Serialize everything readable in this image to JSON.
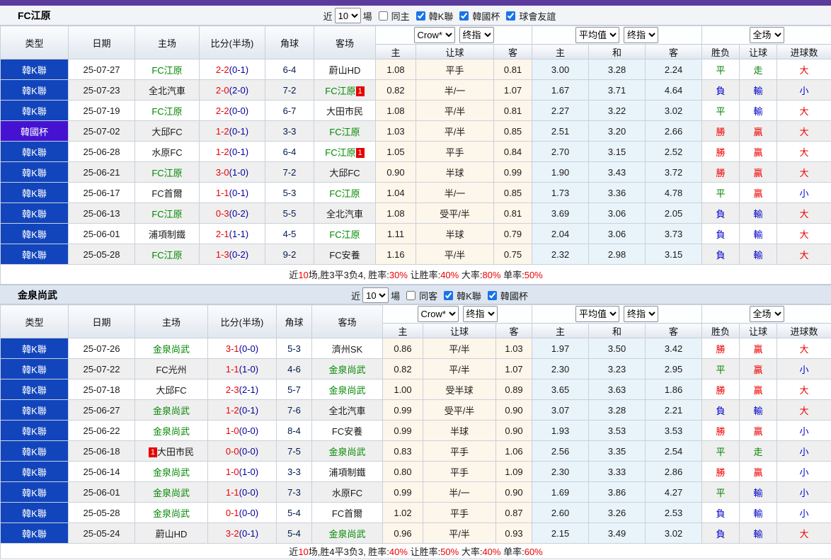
{
  "colors": {
    "accent_topbar": "#5b3c9c",
    "league_kleague": "#1245bc",
    "league_cup": "#4612d2",
    "team_focus_green": "#008800",
    "score_ft_red": "#ee0000",
    "score_ht_navy": "#0000a0",
    "checkbox_blue": "#1a73e8"
  },
  "res_colors": {
    "勝": "red",
    "贏": "red",
    "大": "red",
    "平": "green",
    "走": "green",
    "負": "blue",
    "輸": "blue",
    "小": "blue"
  },
  "columns": {
    "type": "类型",
    "date": "日期",
    "home": "主场",
    "score": "比分(半场)",
    "corner": "角球",
    "away": "客场",
    "sub": [
      "主",
      "让球",
      "客",
      "主",
      "和",
      "客",
      "胜负",
      "让球",
      "进球数"
    ]
  },
  "selects": {
    "odds1_src": "Crow*",
    "odds1_time": "终指",
    "odds2_src": "平均值",
    "odds2_time": "终指",
    "scope": "全场"
  },
  "table1": {
    "title": "FC江原",
    "controls": {
      "near_label": "近",
      "games_value": "10",
      "games_label": "場",
      "checks": [
        {
          "label": "同主",
          "checked": false
        },
        {
          "label": "韓K聯",
          "checked": true
        },
        {
          "label": "韓國杯",
          "checked": true
        },
        {
          "label": "球會友誼",
          "checked": true
        }
      ]
    },
    "rows": [
      {
        "lg": "韓K聯",
        "date": "25-07-27",
        "home": "FC江原",
        "hf": true,
        "ft": "2-2",
        "ht": "(0-1)",
        "cn": "6-4",
        "away": "蔚山HD",
        "af": false,
        "ah": [
          "1.08",
          "平手",
          "0.81"
        ],
        "eu": [
          "3.00",
          "3.28",
          "2.24"
        ],
        "res": [
          "平",
          "走",
          "大"
        ]
      },
      {
        "lg": "韓K聯",
        "date": "25-07-23",
        "home": "全北汽車",
        "hf": false,
        "ft": "2-0",
        "ht": "(2-0)",
        "cn": "7-2",
        "away": "FC江原",
        "af": true,
        "ab": "1",
        "abp": "after",
        "ah": [
          "0.82",
          "半/一",
          "1.07"
        ],
        "eu": [
          "1.67",
          "3.71",
          "4.64"
        ],
        "res": [
          "負",
          "輸",
          "小"
        ]
      },
      {
        "lg": "韓K聯",
        "date": "25-07-19",
        "home": "FC江原",
        "hf": true,
        "ft": "2-2",
        "ht": "(0-0)",
        "cn": "6-7",
        "away": "大田市民",
        "af": false,
        "ah": [
          "1.08",
          "平/半",
          "0.81"
        ],
        "eu": [
          "2.27",
          "3.22",
          "3.02"
        ],
        "res": [
          "平",
          "輸",
          "大"
        ]
      },
      {
        "lg": "韓國杯",
        "date": "25-07-02",
        "home": "大邱FC",
        "hf": false,
        "ft": "1-2",
        "ht": "(0-1)",
        "cn": "3-3",
        "away": "FC江原",
        "af": true,
        "ah": [
          "1.03",
          "平/半",
          "0.85"
        ],
        "eu": [
          "2.51",
          "3.20",
          "2.66"
        ],
        "res": [
          "勝",
          "贏",
          "大"
        ]
      },
      {
        "lg": "韓K聯",
        "date": "25-06-28",
        "home": "水原FC",
        "hf": false,
        "ft": "1-2",
        "ht": "(0-1)",
        "cn": "6-4",
        "away": "FC江原",
        "af": true,
        "ab": "1",
        "abp": "after",
        "ah": [
          "1.05",
          "平手",
          "0.84"
        ],
        "eu": [
          "2.70",
          "3.15",
          "2.52"
        ],
        "res": [
          "勝",
          "贏",
          "大"
        ]
      },
      {
        "lg": "韓K聯",
        "date": "25-06-21",
        "home": "FC江原",
        "hf": true,
        "ft": "3-0",
        "ht": "(1-0)",
        "cn": "7-2",
        "away": "大邱FC",
        "af": false,
        "ah": [
          "0.90",
          "半球",
          "0.99"
        ],
        "eu": [
          "1.90",
          "3.43",
          "3.72"
        ],
        "res": [
          "勝",
          "贏",
          "大"
        ]
      },
      {
        "lg": "韓K聯",
        "date": "25-06-17",
        "home": "FC首爾",
        "hf": false,
        "ft": "1-1",
        "ht": "(0-1)",
        "cn": "5-3",
        "away": "FC江原",
        "af": true,
        "ah": [
          "1.04",
          "半/一",
          "0.85"
        ],
        "eu": [
          "1.73",
          "3.36",
          "4.78"
        ],
        "res": [
          "平",
          "贏",
          "小"
        ]
      },
      {
        "lg": "韓K聯",
        "date": "25-06-13",
        "home": "FC江原",
        "hf": true,
        "ft": "0-3",
        "ht": "(0-2)",
        "cn": "5-5",
        "away": "全北汽車",
        "af": false,
        "ah": [
          "1.08",
          "受平/半",
          "0.81"
        ],
        "eu": [
          "3.69",
          "3.06",
          "2.05"
        ],
        "res": [
          "負",
          "輸",
          "大"
        ]
      },
      {
        "lg": "韓K聯",
        "date": "25-06-01",
        "home": "浦項制鐵",
        "hf": false,
        "ft": "2-1",
        "ht": "(1-1)",
        "cn": "4-5",
        "away": "FC江原",
        "af": true,
        "ah": [
          "1.11",
          "半球",
          "0.79"
        ],
        "eu": [
          "2.04",
          "3.06",
          "3.73"
        ],
        "res": [
          "負",
          "輸",
          "大"
        ]
      },
      {
        "lg": "韓K聯",
        "date": "25-05-28",
        "home": "FC江原",
        "hf": true,
        "ft": "1-3",
        "ht": "(0-2)",
        "cn": "9-2",
        "away": "FC安養",
        "af": false,
        "ah": [
          "1.16",
          "平/半",
          "0.75"
        ],
        "eu": [
          "2.32",
          "2.98",
          "3.15"
        ],
        "res": [
          "負",
          "輸",
          "大"
        ]
      }
    ],
    "summary": [
      [
        "近",
        "b"
      ],
      [
        "10",
        "r"
      ],
      [
        "场,胜3平3负4, 胜率:",
        "b"
      ],
      [
        "30%",
        "r"
      ],
      [
        " 让胜率:",
        "b"
      ],
      [
        "40%",
        "r"
      ],
      [
        " 大率:",
        "b"
      ],
      [
        "80%",
        "r"
      ],
      [
        " 单率:",
        "b"
      ],
      [
        "50%",
        "r"
      ]
    ]
  },
  "table2": {
    "title": "金泉尚武",
    "controls": {
      "near_label": "近",
      "games_value": "10",
      "games_label": "場",
      "checks": [
        {
          "label": "同客",
          "checked": false
        },
        {
          "label": "韓K聯",
          "checked": true
        },
        {
          "label": "韓國杯",
          "checked": true
        }
      ]
    },
    "rows": [
      {
        "lg": "韓K聯",
        "date": "25-07-26",
        "home": "金泉尚武",
        "hf": true,
        "ft": "3-1",
        "ht": "(0-0)",
        "cn": "5-3",
        "away": "濟州SK",
        "af": false,
        "ah": [
          "0.86",
          "平/半",
          "1.03"
        ],
        "eu": [
          "1.97",
          "3.50",
          "3.42"
        ],
        "res": [
          "勝",
          "贏",
          "大"
        ]
      },
      {
        "lg": "韓K聯",
        "date": "25-07-22",
        "home": "FC光州",
        "hf": false,
        "ft": "1-1",
        "ht": "(1-0)",
        "cn": "4-6",
        "away": "金泉尚武",
        "af": true,
        "ah": [
          "0.82",
          "平/半",
          "1.07"
        ],
        "eu": [
          "2.30",
          "3.23",
          "2.95"
        ],
        "res": [
          "平",
          "贏",
          "小"
        ]
      },
      {
        "lg": "韓K聯",
        "date": "25-07-18",
        "home": "大邱FC",
        "hf": false,
        "ft": "2-3",
        "ht": "(2-1)",
        "cn": "5-7",
        "away": "金泉尚武",
        "af": true,
        "ah": [
          "1.00",
          "受半球",
          "0.89"
        ],
        "eu": [
          "3.65",
          "3.63",
          "1.86"
        ],
        "res": [
          "勝",
          "贏",
          "大"
        ]
      },
      {
        "lg": "韓K聯",
        "date": "25-06-27",
        "home": "金泉尚武",
        "hf": true,
        "ft": "1-2",
        "ht": "(0-1)",
        "cn": "7-6",
        "away": "全北汽車",
        "af": false,
        "ah": [
          "0.99",
          "受平/半",
          "0.90"
        ],
        "eu": [
          "3.07",
          "3.28",
          "2.21"
        ],
        "res": [
          "負",
          "輸",
          "大"
        ]
      },
      {
        "lg": "韓K聯",
        "date": "25-06-22",
        "home": "金泉尚武",
        "hf": true,
        "ft": "1-0",
        "ht": "(0-0)",
        "cn": "8-4",
        "away": "FC安養",
        "af": false,
        "ah": [
          "0.99",
          "半球",
          "0.90"
        ],
        "eu": [
          "1.93",
          "3.53",
          "3.53"
        ],
        "res": [
          "勝",
          "贏",
          "小"
        ]
      },
      {
        "lg": "韓K聯",
        "date": "25-06-18",
        "home": "大田市民",
        "hf": false,
        "hb": "1",
        "hbp": "before",
        "ft": "0-0",
        "ht": "(0-0)",
        "cn": "7-5",
        "away": "金泉尚武",
        "af": true,
        "ah": [
          "0.83",
          "平手",
          "1.06"
        ],
        "eu": [
          "2.56",
          "3.35",
          "2.54"
        ],
        "res": [
          "平",
          "走",
          "小"
        ]
      },
      {
        "lg": "韓K聯",
        "date": "25-06-14",
        "home": "金泉尚武",
        "hf": true,
        "ft": "1-0",
        "ht": "(1-0)",
        "cn": "3-3",
        "away": "浦項制鐵",
        "af": false,
        "ah": [
          "0.80",
          "平手",
          "1.09"
        ],
        "eu": [
          "2.30",
          "3.33",
          "2.86"
        ],
        "res": [
          "勝",
          "贏",
          "小"
        ]
      },
      {
        "lg": "韓K聯",
        "date": "25-06-01",
        "home": "金泉尚武",
        "hf": true,
        "ft": "1-1",
        "ht": "(0-0)",
        "cn": "7-3",
        "away": "水原FC",
        "af": false,
        "ah": [
          "0.99",
          "半/一",
          "0.90"
        ],
        "eu": [
          "1.69",
          "3.86",
          "4.27"
        ],
        "res": [
          "平",
          "輸",
          "小"
        ]
      },
      {
        "lg": "韓K聯",
        "date": "25-05-28",
        "home": "金泉尚武",
        "hf": true,
        "ft": "0-1",
        "ht": "(0-0)",
        "cn": "5-4",
        "away": "FC首爾",
        "af": false,
        "ah": [
          "1.02",
          "平手",
          "0.87"
        ],
        "eu": [
          "2.60",
          "3.26",
          "2.53"
        ],
        "res": [
          "負",
          "輸",
          "小"
        ]
      },
      {
        "lg": "韓K聯",
        "date": "25-05-24",
        "home": "蔚山HD",
        "hf": false,
        "ft": "3-2",
        "ht": "(0-1)",
        "cn": "5-4",
        "away": "金泉尚武",
        "af": true,
        "ah": [
          "0.96",
          "平/半",
          "0.93"
        ],
        "eu": [
          "2.15",
          "3.49",
          "3.02"
        ],
        "res": [
          "負",
          "輸",
          "大"
        ]
      }
    ],
    "summary": [
      [
        "近",
        "b"
      ],
      [
        "10",
        "r"
      ],
      [
        "场,胜4平3负3, 胜率:",
        "b"
      ],
      [
        "40%",
        "r"
      ],
      [
        " 让胜率:",
        "b"
      ],
      [
        "50%",
        "r"
      ],
      [
        " 大率:",
        "b"
      ],
      [
        "40%",
        "r"
      ],
      [
        " 单率:",
        "b"
      ],
      [
        "60%",
        "r"
      ]
    ]
  }
}
